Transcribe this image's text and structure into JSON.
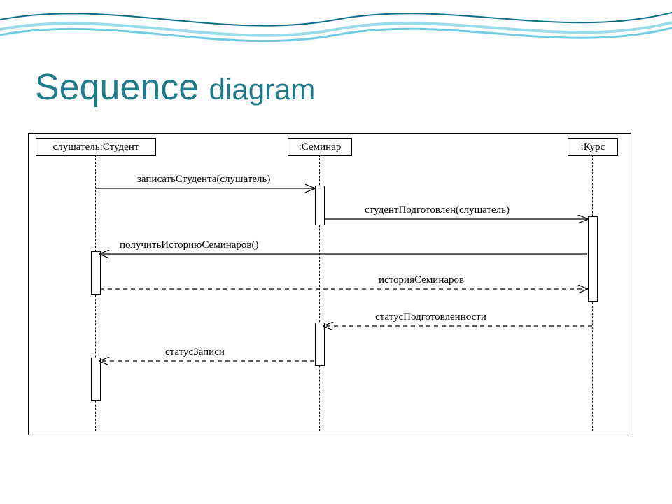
{
  "title_main": "Sequence",
  "title_sub": "diagram",
  "participants": {
    "student": "слушатель:Студент",
    "seminar": ":Семинар",
    "course": ":Курс"
  },
  "messages": {
    "m1": "записатьСтудента(слушатель)",
    "m2": "студентПодготовлен(слушатель)",
    "m3": "получитьИсториюСеминаров()",
    "m4": "историяСеминаров",
    "m5": "статусПодготовленности",
    "m6": "статусЗаписи"
  },
  "colors": {
    "title": "#1f7a8c",
    "wave_dark": "#0b6e87",
    "wave_light": "#6ecde0"
  }
}
